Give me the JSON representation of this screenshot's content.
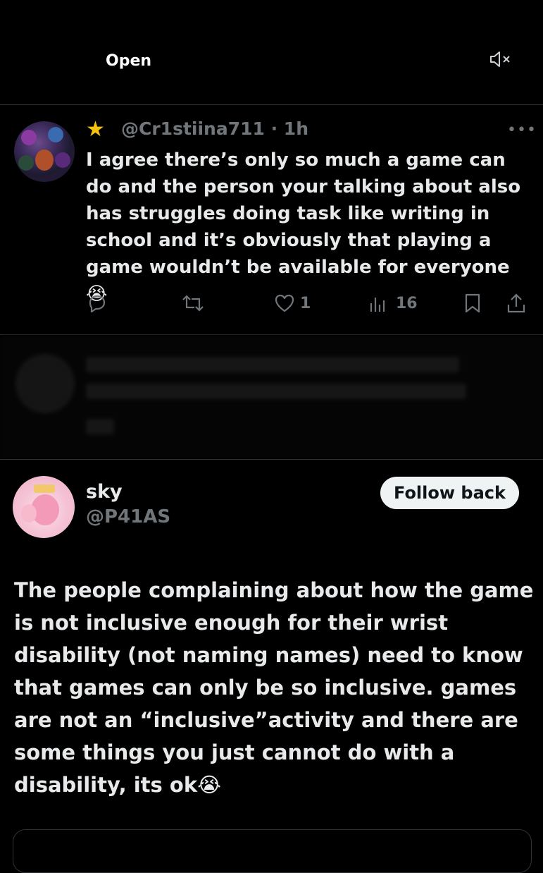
{
  "header": {
    "open_label": "Open",
    "mute_icon": "speaker-muted-icon"
  },
  "reply": {
    "badge_icon": "star-icon",
    "handle": "@Cr1stiina711 · 1h",
    "text": "I agree there’s only so much a game can do and the person your talking about also has struggles doing task like writing in school and it’s obviously that playing a game wouldn’t be available for everyone 😭",
    "likes": "1",
    "views": "16",
    "more_label": "•••"
  },
  "post": {
    "name": "sky",
    "handle": "@P41AS",
    "follow_label": "Follow back",
    "text": "The people complaining about how the game is not inclusive enough for their wrist disability (not naming names) need to know that games can only be so inclusive. games are not an “inclusive”activity and there are some things you just cannot do with a disability, its ok😭"
  },
  "colors": {
    "background": "#000000",
    "text": "#e7e9ea",
    "muted": "#71767b",
    "star": "#f4c20d",
    "button": "#eff3f4"
  }
}
